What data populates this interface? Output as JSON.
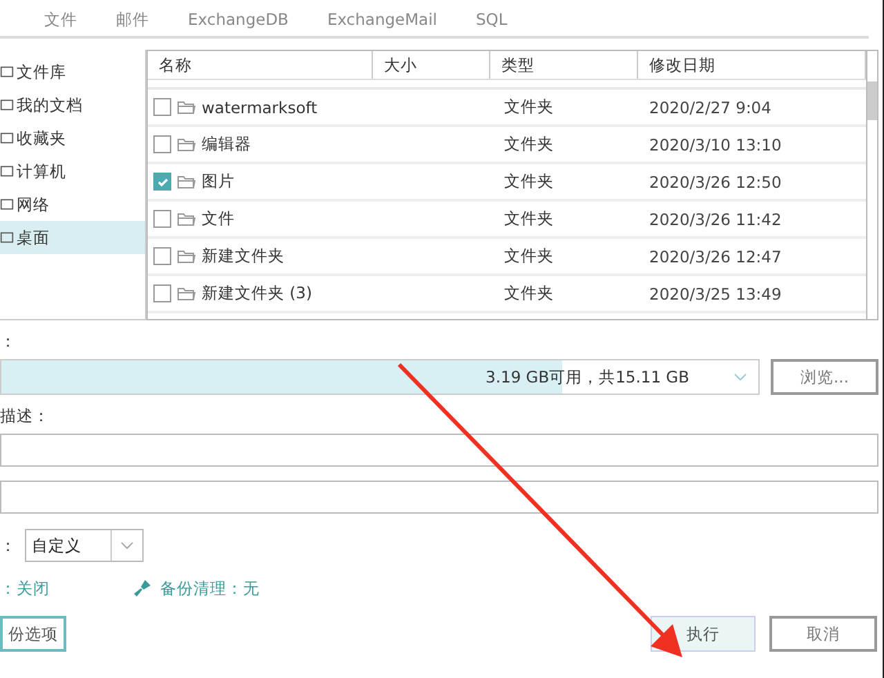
{
  "tabs": [
    {
      "label": "文件",
      "selected": false
    },
    {
      "label": "邮件",
      "selected": false
    },
    {
      "label": "ExchangeDB",
      "selected": false
    },
    {
      "label": "ExchangeMail",
      "selected": false
    },
    {
      "label": "SQL",
      "selected": false
    }
  ],
  "sidebar": {
    "items": [
      {
        "label": "文件库",
        "selected": false
      },
      {
        "label": "我的文档",
        "selected": false
      },
      {
        "label": "收藏夹",
        "selected": false
      },
      {
        "label": "计算机",
        "selected": false
      },
      {
        "label": "网络",
        "selected": false
      },
      {
        "label": "桌面",
        "selected": true
      }
    ]
  },
  "table": {
    "columns": [
      "名称",
      "大小",
      "类型",
      "修改日期"
    ],
    "rows": [
      {
        "name": "watermarksoft",
        "type": "文件夹",
        "modified": "2020/2/27 9:04",
        "checked": false
      },
      {
        "name": "编辑器",
        "type": "文件夹",
        "modified": "2020/3/10 13:10",
        "checked": false
      },
      {
        "name": "图片",
        "type": "文件夹",
        "modified": "2020/3/26 12:50",
        "checked": true
      },
      {
        "name": "文件",
        "type": "文件夹",
        "modified": "2020/3/26 11:42",
        "checked": false
      },
      {
        "name": "新建文件夹",
        "type": "文件夹",
        "modified": "2020/3/26 12:47",
        "checked": false
      },
      {
        "name": "新建文件夹 (3)",
        "type": "文件夹",
        "modified": "2020/3/25 13:49",
        "checked": false
      }
    ]
  },
  "destination": {
    "label": "：",
    "space": "3.19 GB可用，共15.11 GB",
    "level": 0.74,
    "browse": "浏览..."
  },
  "description": {
    "label": "描述："
  },
  "mode": {
    "label": "：",
    "value": "自定义"
  },
  "info": {
    "left": "：关闭",
    "cleanup": "备份清理：无"
  },
  "buttons": {
    "options": "份选项",
    "run": "执行",
    "cancel": "取消"
  }
}
